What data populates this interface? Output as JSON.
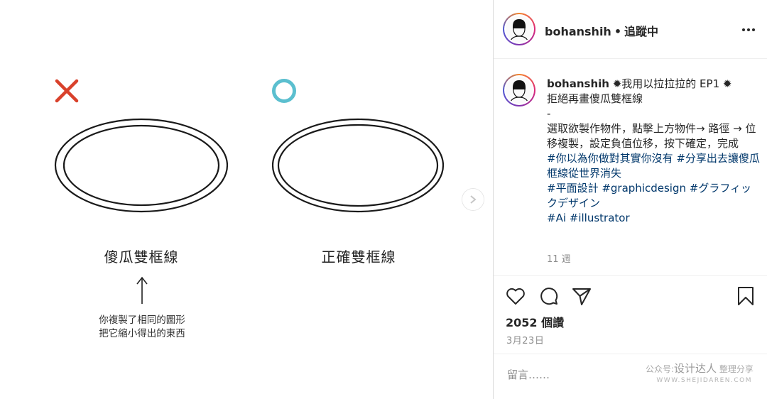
{
  "post_image": {
    "wrong_label": "傻瓜雙框線",
    "right_label": "正確雙框線",
    "note_line1": "你複製了相同的圖形",
    "note_line2": "把它縮小得出的東西",
    "wrong_mark_color": "#d9412b",
    "right_mark_color": "#5bbfcf",
    "icons": [
      "cross-mark-icon",
      "circle-mark-icon",
      "arrow-up-icon",
      "chevron-right-icon"
    ]
  },
  "header": {
    "username": "bohanshih",
    "separator": "•",
    "follow_status": "追蹤中",
    "more_icon": "more-horizontal-icon"
  },
  "caption": {
    "username": "bohanshih",
    "title": " ✹我用以拉拉拉的 EP1 ✹",
    "line2": "拒絕再畫傻瓜雙框線",
    "line3": "-",
    "body": "選取欲製作物件，點擊上方物件→ 路徑 → 位移複製，設定負值位移，按下確定，完成",
    "tags_line1": "#你以為你做對其實你沒有 #分享出去讓傻瓜框線從世界消失",
    "tags_line2": "#平面設計 #graphicdesign #グラフィックデザイン",
    "tags_line3": "#Ai #illustrator",
    "time": "11 週"
  },
  "actions": {
    "icons": [
      "heart-icon",
      "comment-icon",
      "share-icon",
      "bookmark-icon"
    ],
    "views": "2052 個讚",
    "date": "3月23日"
  },
  "comment": {
    "placeholder": "留言……"
  },
  "watermark": {
    "prefix": "公众号:",
    "brand": "设计达人",
    "suffix": "整理分享",
    "url": "WWW.SHEJIDAREN.COM"
  },
  "colors": {
    "link": "#00376b",
    "muted": "#8e8e8e",
    "text": "#262626",
    "border": "#dbdbdb"
  }
}
